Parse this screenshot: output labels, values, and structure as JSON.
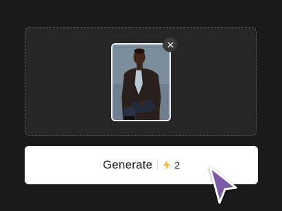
{
  "upload": {
    "remove_icon": "close-icon",
    "image_icon": "portrait-photo"
  },
  "generate": {
    "label": "Generate",
    "credit_icon": "lightning-icon",
    "credits": "2"
  },
  "colors": {
    "background": "#1a1a1b",
    "dropzone": "#262627",
    "button": "#ffffff",
    "bolt": "#f5b731",
    "cursor": "#7b5aa6"
  }
}
